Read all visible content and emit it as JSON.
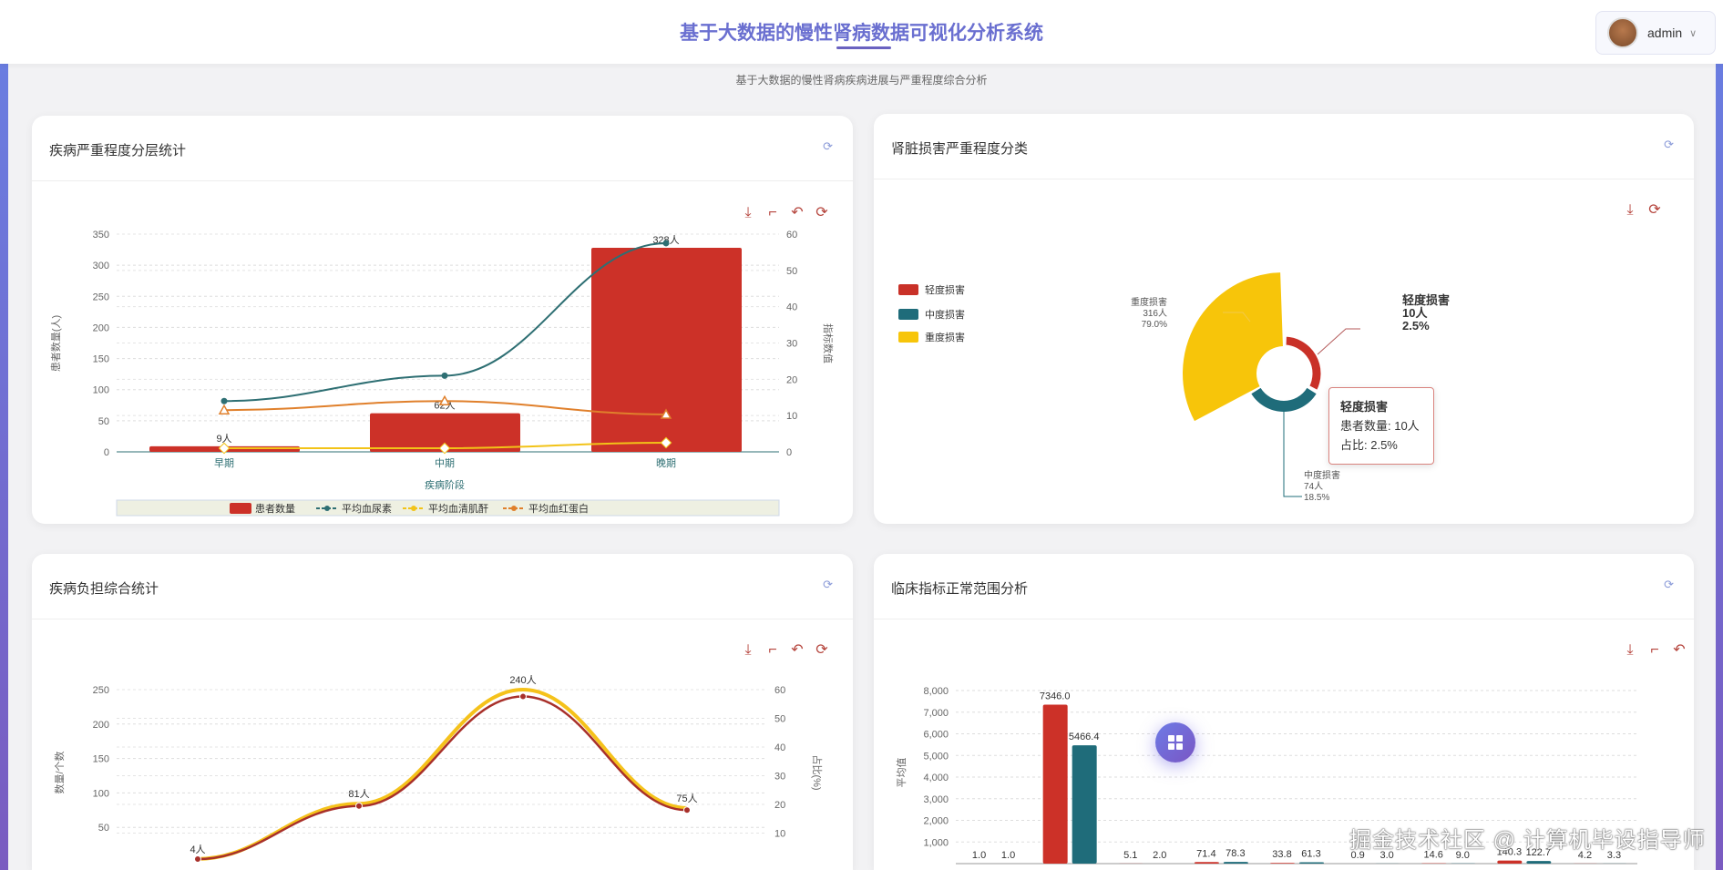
{
  "header": {
    "title": "基于大数据的慢性肾病数据可视化分析系统",
    "user": "admin",
    "subtitle": "基于大数据的慢性肾病疾病进展与严重程度综合分析"
  },
  "icons": {
    "refresh": "refresh-icon",
    "download": "download-icon",
    "zoom": "data-zoom-icon",
    "zoom_reset": "zoom-reset-icon",
    "restore": "restore-icon",
    "menu": "grid-menu-icon"
  },
  "watermark": "掘金技术社区 @ 计算机毕设指导师",
  "cards": [
    {
      "title": "疾病严重程度分层统计"
    },
    {
      "title": "肾脏损害严重程度分类"
    },
    {
      "title": "疾病负担综合统计"
    },
    {
      "title": "临床指标正常范围分析"
    }
  ],
  "tooltip": {
    "title": "轻度损害",
    "count": "患者数量: 10人",
    "ratio": "占比: 2.5%"
  },
  "chart_data": [
    {
      "type": "bar",
      "title": "疾病严重程度分层统计",
      "categories": [
        "早期",
        "中期",
        "晚期"
      ],
      "xlabel": "疾病阶段",
      "ylabel": "患者数量(人)",
      "ylabel_right": "指标数值",
      "ylim": [
        0,
        350
      ],
      "ylim_right": [
        0,
        60
      ],
      "yticks": [
        "0",
        "50",
        "100",
        "150",
        "200",
        "250",
        "300",
        "350"
      ],
      "yticks_right": [
        "0",
        "10",
        "20",
        "30",
        "40",
        "50",
        "60"
      ],
      "series": [
        {
          "name": "患者数量",
          "type": "bar",
          "values": [
            9,
            62,
            328
          ],
          "labels": [
            "9人",
            "62人",
            "328人"
          ],
          "color": "#cc3128"
        },
        {
          "name": "平均血尿素",
          "type": "line",
          "values": [
            14,
            21,
            57.5
          ],
          "color": "#2e6f73"
        },
        {
          "name": "平均血清肌酐",
          "type": "line",
          "values": [
            1,
            1,
            2.5
          ],
          "color": "#f2c318"
        },
        {
          "name": "平均血红蛋白",
          "type": "line",
          "values": [
            11.5,
            14,
            10.3
          ],
          "color": "#e0802c"
        }
      ]
    },
    {
      "type": "pie",
      "title": "肾脏损害严重程度分类",
      "legend": "left",
      "slices": [
        {
          "name": "轻度损害",
          "value": 10,
          "label": "10人",
          "pct": "2.5%",
          "color": "#c93128"
        },
        {
          "name": "中度损害",
          "value": 74,
          "label": "74人",
          "pct": "18.5%",
          "color": "#1f6c7a"
        },
        {
          "name": "重度损害",
          "value": 316,
          "label": "316人",
          "pct": "79.0%",
          "color": "#f7c50a"
        }
      ]
    },
    {
      "type": "line",
      "title": "疾病负担综合统计",
      "ylabel": "数量/个数",
      "ylabel_right": "占比(%)",
      "ylim": [
        0,
        250
      ],
      "ylim_right": [
        0,
        60
      ],
      "yticks": [
        "50",
        "100",
        "150",
        "200",
        "250"
      ],
      "yticks_right": [
        "10",
        "20",
        "30",
        "40",
        "50",
        "60"
      ],
      "series": [
        {
          "name": "数量",
          "values": [
            4,
            81,
            240,
            75
          ],
          "labels": [
            "4人",
            "81人",
            "240人",
            "75人"
          ],
          "color": "#a8302a"
        },
        {
          "name": "占比",
          "values": [
            1,
            20.25,
            60,
            18.75
          ],
          "color": "#f5c21b"
        }
      ]
    },
    {
      "type": "bar",
      "title": "临床指标正常范围分析",
      "ylabel": "平均值",
      "ylim": [
        0,
        8000
      ],
      "yticks": [
        "1,000",
        "2,000",
        "3,000",
        "4,000",
        "5,000",
        "6,000",
        "7,000",
        "8,000"
      ],
      "series": [
        {
          "values": [
            1.0,
            7346.0,
            5.1,
            71.4,
            33.8,
            0.9,
            14.6,
            140.3,
            4.2
          ],
          "labels": [
            "1.0",
            "7346.0",
            "5.1",
            "71.4",
            "33.8",
            "0.9",
            "14.6",
            "140.3",
            "4.2"
          ],
          "color": "#cc3128"
        },
        {
          "values": [
            1.0,
            5466.4,
            2.0,
            78.3,
            61.3,
            3.0,
            9.0,
            122.7,
            3.3
          ],
          "labels": [
            "1.0",
            "5466.4",
            "2.0",
            "78.3",
            "61.3",
            "3.0",
            "9.0",
            "122.7",
            "3.3"
          ],
          "color": "#1f6c7a"
        }
      ]
    }
  ]
}
